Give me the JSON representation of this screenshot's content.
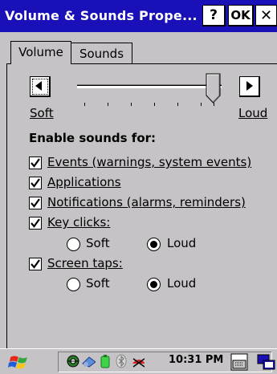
{
  "window": {
    "title": "Volume & Sounds Prope...",
    "help_label": "?",
    "ok_label": "OK",
    "close_label": "✕"
  },
  "tabs": [
    {
      "label": "Volume",
      "active": true
    },
    {
      "label": "Sounds",
      "active": false
    }
  ],
  "volume": {
    "down_icon": "left-arrow-icon",
    "up_icon": "right-arrow-icon",
    "soft_label": "Soft",
    "loud_label": "Loud",
    "level": 0.92
  },
  "enable_sounds": {
    "heading": "Enable sounds for:",
    "items": [
      {
        "label": "Events (warnings, system events)",
        "checked": true
      },
      {
        "label": "Applications",
        "checked": true
      },
      {
        "label": "Notifications (alarms, reminders)",
        "checked": true
      },
      {
        "label": "Key clicks:",
        "checked": true,
        "options": [
          {
            "label": "Soft",
            "selected": false
          },
          {
            "label": "Loud",
            "selected": true
          }
        ]
      },
      {
        "label": "Screen taps:",
        "checked": true,
        "options": [
          {
            "label": "Soft",
            "selected": false
          },
          {
            "label": "Loud",
            "selected": true
          }
        ]
      }
    ]
  },
  "taskbar": {
    "start_icon": "windows-flag-icon",
    "tray_icons": [
      "network-icon",
      "connection-icon",
      "battery-icon",
      "bluetooth-icon",
      "volume-icon"
    ],
    "time": "10:31 PM",
    "keyboard_icon": "keyboard-icon",
    "desktop_icon": "switch-windows-icon"
  },
  "colors": {
    "title_bar": "#1a10b8",
    "dialog_bg": "#c6c3c6"
  }
}
